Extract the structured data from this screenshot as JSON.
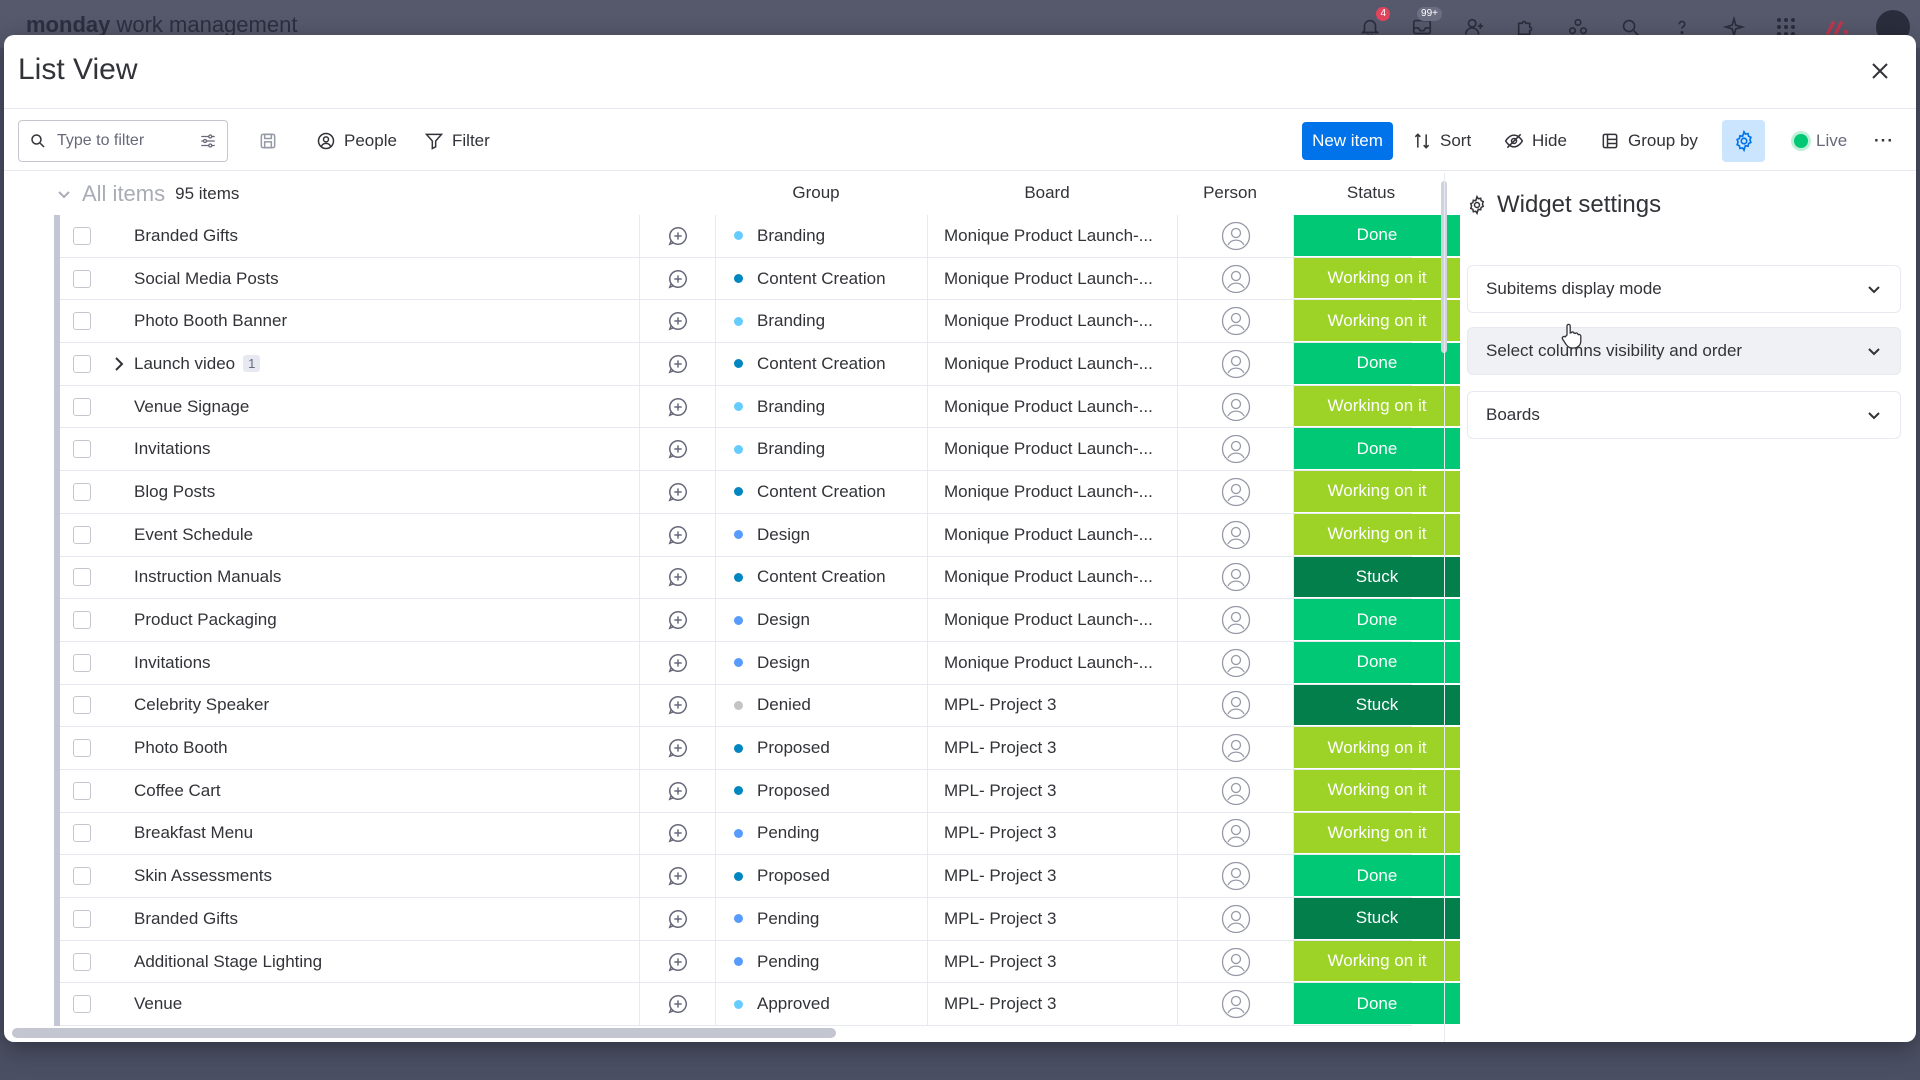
{
  "app": {
    "brand_bold": "monday",
    "brand_light": " work management",
    "notifications_badge": "4",
    "inbox_badge": "99+"
  },
  "modal": {
    "title": "List View"
  },
  "toolbar": {
    "search_placeholder": "Type to filter",
    "people_label": "People",
    "filter_label": "Filter",
    "new_item_label": "New item",
    "sort_label": "Sort",
    "hide_label": "Hide",
    "group_by_label": "Group by",
    "live_label": "Live",
    "more_label": "···"
  },
  "table": {
    "group_title": "All items",
    "group_count": "95 items",
    "headers": {
      "group": "Group",
      "board": "Board",
      "person": "Person",
      "status": "Status"
    },
    "rows": [
      {
        "name": "Branded Gifts",
        "group": "Branding",
        "group_color": "#66ccff",
        "board": "Monique Product Launch-...",
        "status": "Done",
        "status_color": "#00c875",
        "subitems": ""
      },
      {
        "name": "Social Media Posts",
        "group": "Content Creation",
        "group_color": "#0086c0",
        "board": "Monique Product Launch-...",
        "status": "Working on it",
        "status_color": "#9cd326",
        "subitems": ""
      },
      {
        "name": "Photo Booth Banner",
        "group": "Branding",
        "group_color": "#66ccff",
        "board": "Monique Product Launch-...",
        "status": "Working on it",
        "status_color": "#9cd326",
        "subitems": ""
      },
      {
        "name": "Launch video",
        "group": "Content Creation",
        "group_color": "#0086c0",
        "board": "Monique Product Launch-...",
        "status": "Done",
        "status_color": "#00c875",
        "subitems": "1"
      },
      {
        "name": "Venue Signage",
        "group": "Branding",
        "group_color": "#66ccff",
        "board": "Monique Product Launch-...",
        "status": "Working on it",
        "status_color": "#9cd326",
        "subitems": ""
      },
      {
        "name": "Invitations",
        "group": "Branding",
        "group_color": "#66ccff",
        "board": "Monique Product Launch-...",
        "status": "Done",
        "status_color": "#00c875",
        "subitems": ""
      },
      {
        "name": "Blog Posts",
        "group": "Content Creation",
        "group_color": "#0086c0",
        "board": "Monique Product Launch-...",
        "status": "Working on it",
        "status_color": "#9cd326",
        "subitems": ""
      },
      {
        "name": "Event Schedule",
        "group": "Design",
        "group_color": "#579bfc",
        "board": "Monique Product Launch-...",
        "status": "Working on it",
        "status_color": "#9cd326",
        "subitems": ""
      },
      {
        "name": "Instruction Manuals",
        "group": "Content Creation",
        "group_color": "#0086c0",
        "board": "Monique Product Launch-...",
        "status": "Stuck",
        "status_color": "#037f4c",
        "subitems": ""
      },
      {
        "name": "Product Packaging",
        "group": "Design",
        "group_color": "#579bfc",
        "board": "Monique Product Launch-...",
        "status": "Done",
        "status_color": "#00c875",
        "subitems": ""
      },
      {
        "name": "Invitations",
        "group": "Design",
        "group_color": "#579bfc",
        "board": "Monique Product Launch-...",
        "status": "Done",
        "status_color": "#00c875",
        "subitems": ""
      },
      {
        "name": "Celebrity Speaker",
        "group": "Denied",
        "group_color": "#c4c4c4",
        "board": "MPL- Project 3",
        "status": "Stuck",
        "status_color": "#037f4c",
        "subitems": ""
      },
      {
        "name": "Photo Booth",
        "group": "Proposed",
        "group_color": "#0086c0",
        "board": "MPL- Project 3",
        "status": "Working on it",
        "status_color": "#9cd326",
        "subitems": ""
      },
      {
        "name": "Coffee Cart",
        "group": "Proposed",
        "group_color": "#0086c0",
        "board": "MPL- Project 3",
        "status": "Working on it",
        "status_color": "#9cd326",
        "subitems": ""
      },
      {
        "name": "Breakfast Menu",
        "group": "Pending",
        "group_color": "#579bfc",
        "board": "MPL- Project 3",
        "status": "Working on it",
        "status_color": "#9cd326",
        "subitems": ""
      },
      {
        "name": "Skin Assessments",
        "group": "Proposed",
        "group_color": "#0086c0",
        "board": "MPL- Project 3",
        "status": "Done",
        "status_color": "#00c875",
        "subitems": ""
      },
      {
        "name": "Branded Gifts",
        "group": "Pending",
        "group_color": "#579bfc",
        "board": "MPL- Project 3",
        "status": "Stuck",
        "status_color": "#037f4c",
        "subitems": ""
      },
      {
        "name": "Additional Stage Lighting",
        "group": "Pending",
        "group_color": "#579bfc",
        "board": "MPL- Project 3",
        "status": "Working on it",
        "status_color": "#9cd326",
        "subitems": ""
      },
      {
        "name": "Venue",
        "group": "Approved",
        "group_color": "#66ccff",
        "board": "MPL- Project 3",
        "status": "Done",
        "status_color": "#00c875",
        "subitems": ""
      }
    ]
  },
  "panel": {
    "title": "Widget settings",
    "sections": [
      {
        "label": "Subitems display mode"
      },
      {
        "label": "Select columns visibility and order"
      },
      {
        "label": "Boards"
      }
    ]
  },
  "colors": {
    "accent": "#0073ea",
    "done": "#00c875",
    "working": "#9cd326",
    "stuck": "#037f4c"
  }
}
